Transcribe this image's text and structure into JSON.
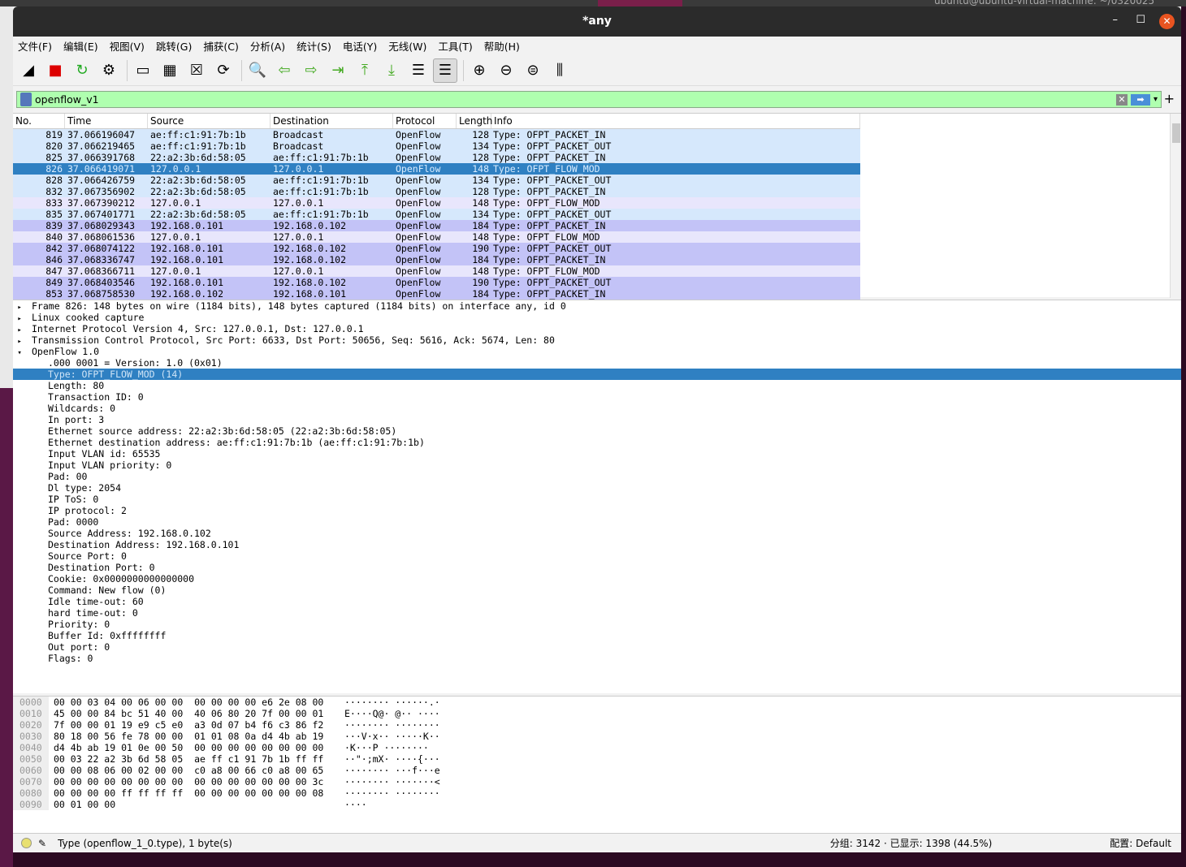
{
  "window": {
    "title": "*any",
    "desktop_terminal_title": "ubuntu@ubuntu-virtual-machine: ~/0320025"
  },
  "menu": [
    "文件(F)",
    "编辑(E)",
    "视图(V)",
    "跳转(G)",
    "捕获(C)",
    "分析(A)",
    "统计(S)",
    "电话(Y)",
    "无线(W)",
    "工具(T)",
    "帮助(H)"
  ],
  "toolbar": [
    {
      "name": "start-capture",
      "glyph": "◢"
    },
    {
      "name": "stop-capture",
      "glyph": "■",
      "color": "#dd0000"
    },
    {
      "name": "restart-capture",
      "glyph": "↻",
      "color": "#22aa22"
    },
    {
      "name": "capture-options",
      "glyph": "⚙"
    },
    {
      "sep": true
    },
    {
      "name": "open-file",
      "glyph": "▭"
    },
    {
      "name": "save-file",
      "glyph": "▦"
    },
    {
      "name": "close-file",
      "glyph": "☒"
    },
    {
      "name": "reload-file",
      "glyph": "⟳"
    },
    {
      "sep": true
    },
    {
      "name": "find-packet",
      "glyph": "🔍"
    },
    {
      "name": "go-back",
      "glyph": "⇦",
      "color": "#44aa22"
    },
    {
      "name": "go-forward",
      "glyph": "⇨",
      "color": "#44aa22"
    },
    {
      "name": "go-to-packet",
      "glyph": "⇥",
      "color": "#44aa22"
    },
    {
      "name": "go-first",
      "glyph": "⤒",
      "color": "#44aa22"
    },
    {
      "name": "go-last",
      "glyph": "⤓",
      "color": "#44aa22"
    },
    {
      "name": "auto-scroll",
      "glyph": "☰"
    },
    {
      "name": "colorize",
      "glyph": "☰",
      "active": true
    },
    {
      "sep": true
    },
    {
      "name": "zoom-in",
      "glyph": "⊕"
    },
    {
      "name": "zoom-out",
      "glyph": "⊖"
    },
    {
      "name": "zoom-reset",
      "glyph": "⊜"
    },
    {
      "name": "resize-columns",
      "glyph": "⫼"
    }
  ],
  "filter": {
    "value": "openflow_v1",
    "color": "#afffaf"
  },
  "packet_list": {
    "columns": [
      "No.",
      "Time",
      "Source",
      "Destination",
      "Protocol",
      "Length",
      "Info"
    ],
    "colors": {
      "blue": "#d6e8fc",
      "lavender": "#e8e6fc",
      "purple": "#c3c3f7",
      "selected": "#2f80c2"
    },
    "rows": [
      {
        "no": "819",
        "time": "37.066196047",
        "src": "ae:ff:c1:91:7b:1b",
        "dst": "Broadcast",
        "proto": "OpenFlow",
        "len": "128",
        "info": "Type: OFPT_PACKET_IN",
        "color": "blue"
      },
      {
        "no": "820",
        "time": "37.066219465",
        "src": "ae:ff:c1:91:7b:1b",
        "dst": "Broadcast",
        "proto": "OpenFlow",
        "len": "134",
        "info": "Type: OFPT_PACKET_OUT",
        "color": "blue"
      },
      {
        "no": "825",
        "time": "37.066391768",
        "src": "22:a2:3b:6d:58:05",
        "dst": "ae:ff:c1:91:7b:1b",
        "proto": "OpenFlow",
        "len": "128",
        "info": "Type: OFPT_PACKET_IN",
        "color": "blue"
      },
      {
        "no": "826",
        "time": "37.066419071",
        "src": "127.0.0.1",
        "dst": "127.0.0.1",
        "proto": "OpenFlow",
        "len": "148",
        "info": "Type: OFPT_FLOW_MOD",
        "color": "selected"
      },
      {
        "no": "828",
        "time": "37.066426759",
        "src": "22:a2:3b:6d:58:05",
        "dst": "ae:ff:c1:91:7b:1b",
        "proto": "OpenFlow",
        "len": "134",
        "info": "Type: OFPT_PACKET_OUT",
        "color": "blue"
      },
      {
        "no": "832",
        "time": "37.067356902",
        "src": "22:a2:3b:6d:58:05",
        "dst": "ae:ff:c1:91:7b:1b",
        "proto": "OpenFlow",
        "len": "128",
        "info": "Type: OFPT_PACKET_IN",
        "color": "blue"
      },
      {
        "no": "833",
        "time": "37.067390212",
        "src": "127.0.0.1",
        "dst": "127.0.0.1",
        "proto": "OpenFlow",
        "len": "148",
        "info": "Type: OFPT_FLOW_MOD",
        "color": "lavender"
      },
      {
        "no": "835",
        "time": "37.067401771",
        "src": "22:a2:3b:6d:58:05",
        "dst": "ae:ff:c1:91:7b:1b",
        "proto": "OpenFlow",
        "len": "134",
        "info": "Type: OFPT_PACKET_OUT",
        "color": "blue"
      },
      {
        "no": "839",
        "time": "37.068029343",
        "src": "192.168.0.101",
        "dst": "192.168.0.102",
        "proto": "OpenFlow",
        "len": "184",
        "info": "Type: OFPT_PACKET_IN",
        "color": "purple"
      },
      {
        "no": "840",
        "time": "37.068061536",
        "src": "127.0.0.1",
        "dst": "127.0.0.1",
        "proto": "OpenFlow",
        "len": "148",
        "info": "Type: OFPT_FLOW_MOD",
        "color": "lavender"
      },
      {
        "no": "842",
        "time": "37.068074122",
        "src": "192.168.0.101",
        "dst": "192.168.0.102",
        "proto": "OpenFlow",
        "len": "190",
        "info": "Type: OFPT_PACKET_OUT",
        "color": "purple"
      },
      {
        "no": "846",
        "time": "37.068336747",
        "src": "192.168.0.101",
        "dst": "192.168.0.102",
        "proto": "OpenFlow",
        "len": "184",
        "info": "Type: OFPT_PACKET_IN",
        "color": "purple"
      },
      {
        "no": "847",
        "time": "37.068366711",
        "src": "127.0.0.1",
        "dst": "127.0.0.1",
        "proto": "OpenFlow",
        "len": "148",
        "info": "Type: OFPT_FLOW_MOD",
        "color": "lavender"
      },
      {
        "no": "849",
        "time": "37.068403546",
        "src": "192.168.0.101",
        "dst": "192.168.0.102",
        "proto": "OpenFlow",
        "len": "190",
        "info": "Type: OFPT_PACKET_OUT",
        "color": "purple"
      },
      {
        "no": "853",
        "time": "37.068758530",
        "src": "192.168.0.102",
        "dst": "192.168.0.101",
        "proto": "OpenFlow",
        "len": "184",
        "info": "Type: OFPT_PACKET_IN",
        "color": "purple"
      }
    ]
  },
  "details": [
    {
      "text": "Frame 826: 148 bytes on wire (1184 bits), 148 bytes captured (1184 bits) on interface any, id 0",
      "level": 0,
      "toggle": "collapsed"
    },
    {
      "text": "Linux cooked capture",
      "level": 0,
      "toggle": "collapsed"
    },
    {
      "text": "Internet Protocol Version 4, Src: 127.0.0.1, Dst: 127.0.0.1",
      "level": 0,
      "toggle": "collapsed"
    },
    {
      "text": "Transmission Control Protocol, Src Port: 6633, Dst Port: 50656, Seq: 5616, Ack: 5674, Len: 80",
      "level": 0,
      "toggle": "collapsed"
    },
    {
      "text": "OpenFlow 1.0",
      "level": 0,
      "toggle": "expanded"
    },
    {
      "text": ".000 0001 = Version: 1.0 (0x01)",
      "level": 1
    },
    {
      "text": "Type: OFPT_FLOW_MOD (14)",
      "level": 1,
      "selected": true
    },
    {
      "text": "Length: 80",
      "level": 1
    },
    {
      "text": "Transaction ID: 0",
      "level": 1
    },
    {
      "text": "Wildcards: 0",
      "level": 1
    },
    {
      "text": "In port: 3",
      "level": 1
    },
    {
      "text": "Ethernet source address: 22:a2:3b:6d:58:05 (22:a2:3b:6d:58:05)",
      "level": 1
    },
    {
      "text": "Ethernet destination address: ae:ff:c1:91:7b:1b (ae:ff:c1:91:7b:1b)",
      "level": 1
    },
    {
      "text": "Input VLAN id: 65535",
      "level": 1
    },
    {
      "text": "Input VLAN priority: 0",
      "level": 1
    },
    {
      "text": "Pad: 00",
      "level": 1
    },
    {
      "text": "Dl type: 2054",
      "level": 1
    },
    {
      "text": "IP ToS: 0",
      "level": 1
    },
    {
      "text": "IP protocol: 2",
      "level": 1
    },
    {
      "text": "Pad: 0000",
      "level": 1
    },
    {
      "text": "Source Address: 192.168.0.102",
      "level": 1
    },
    {
      "text": "Destination Address: 192.168.0.101",
      "level": 1
    },
    {
      "text": "Source Port: 0",
      "level": 1
    },
    {
      "text": "Destination Port: 0",
      "level": 1
    },
    {
      "text": "Cookie: 0x0000000000000000",
      "level": 1
    },
    {
      "text": "Command: New flow (0)",
      "level": 1
    },
    {
      "text": "Idle time-out: 60",
      "level": 1
    },
    {
      "text": "hard time-out: 0",
      "level": 1
    },
    {
      "text": "Priority: 0",
      "level": 1
    },
    {
      "text": "Buffer Id: 0xffffffff",
      "level": 1
    },
    {
      "text": "Out port: 0",
      "level": 1
    },
    {
      "text": "Flags: 0",
      "level": 1
    }
  ],
  "hex": [
    {
      "off": "0000",
      "bytes": "00 00 03 04 00 06 00 00  00 00 00 00 e6 2e 08 00",
      "ascii": "········ ······.·"
    },
    {
      "off": "0010",
      "bytes": "45 00 00 84 bc 51 40 00  40 06 80 20 7f 00 00 01",
      "ascii": "E····Q@· @·· ····"
    },
    {
      "off": "0020",
      "bytes": "7f 00 00 01 19 e9 c5 e0  a3 0d 07 b4 f6 c3 86 f2",
      "ascii": "········ ········"
    },
    {
      "off": "0030",
      "bytes": "80 18 00 56 fe 78 00 00  01 01 08 0a d4 4b ab 19",
      "ascii": "···V·x·· ·····K··"
    },
    {
      "off": "0040",
      "bytes": "d4 4b ab 19 01 0e 00 50  00 00 00 00 00 00 00 00",
      "ascii": "·K···P ········"
    },
    {
      "off": "0050",
      "bytes": "00 03 22 a2 3b 6d 58 05  ae ff c1 91 7b 1b ff ff",
      "ascii": "··\"·;mX· ····{···"
    },
    {
      "off": "0060",
      "bytes": "00 00 08 06 00 02 00 00  c0 a8 00 66 c0 a8 00 65",
      "ascii": "········ ···f···e"
    },
    {
      "off": "0070",
      "bytes": "00 00 00 00 00 00 00 00  00 00 00 00 00 00 00 3c",
      "ascii": "········ ·······<"
    },
    {
      "off": "0080",
      "bytes": "00 00 00 00 ff ff ff ff  00 00 00 00 00 00 00 08",
      "ascii": "········ ········"
    },
    {
      "off": "0090",
      "bytes": "00 01 00 00",
      "ascii": "····"
    }
  ],
  "status": {
    "field": "Type (openflow_1_0.type), 1 byte(s)",
    "packets": "分组: 3142 · 已显示: 1398 (44.5%)",
    "profile": "配置: Default"
  }
}
